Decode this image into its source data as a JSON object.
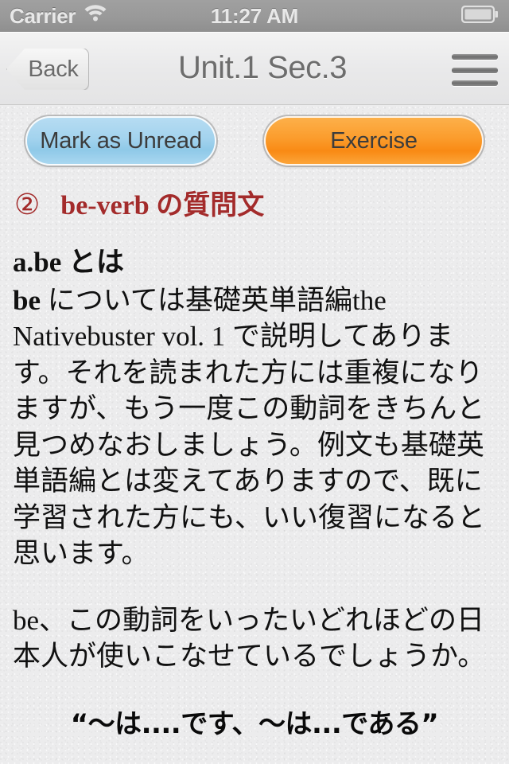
{
  "status_bar": {
    "carrier": "Carrier",
    "wifi_icon": "wifi-icon",
    "time": "11:27 AM",
    "battery_icon": "battery-full-icon"
  },
  "nav_bar": {
    "back_label": "Back",
    "title": "Unit.1 Sec.3",
    "menu_icon": "hamburger-menu-icon"
  },
  "actions": {
    "mark_unread_label": "Mark as Unread",
    "exercise_label": "Exercise",
    "mark_unread_color": "#a3d3ee",
    "exercise_color": "#fb9c2c"
  },
  "content": {
    "section_number": "②",
    "section_title": "be-verb の質問文",
    "section_color": "#a32b2b",
    "subheading": "a.be とは",
    "paragraph_1_lead": "be",
    "paragraph_1": " については基礎英単語編the Nativebuster vol. 1 で説明してあります。それを読まれた方には重複になりますが、もう一度この動詞をきちんと見つめなおしましょう。例文も基礎英単語編とは変えてありますので、既に学習された方にも、いい復習になると思います。",
    "paragraph_2": "be、この動詞をいったいどれほどの日本人が使いこなせているでしょうか。",
    "quote_line": "“〜は....です、〜は...である”"
  }
}
